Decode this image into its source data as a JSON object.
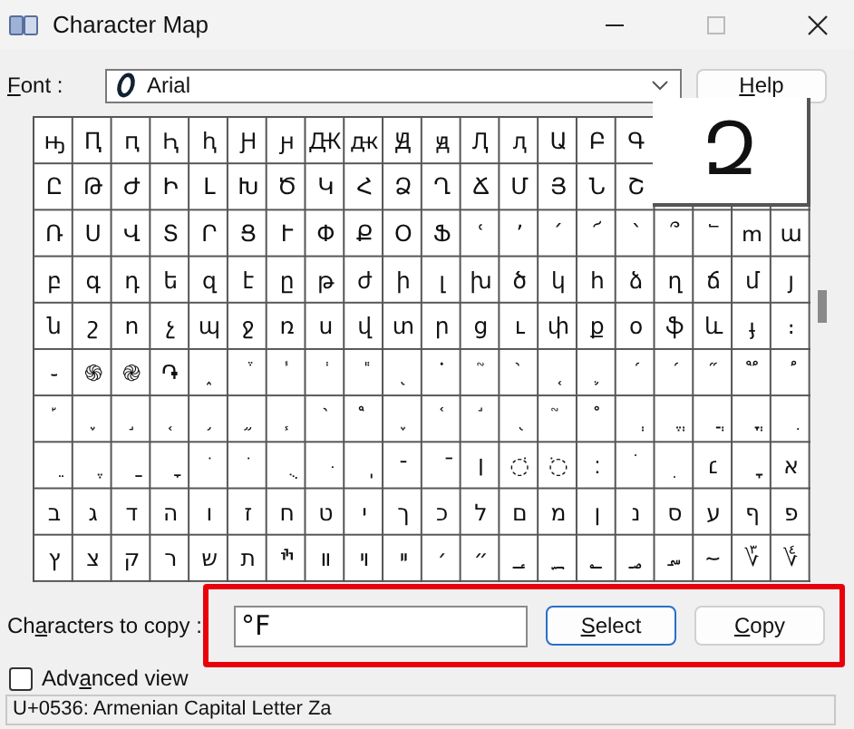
{
  "window": {
    "title": "Character Map"
  },
  "font": {
    "label": "Font :",
    "value": "Arial"
  },
  "help_button": {
    "label": "Help"
  },
  "grid": {
    "rows": [
      [
        "ԣ",
        "Ԥ",
        "ԥ",
        "Ԧ",
        "ԧ",
        "Ԩ",
        "ԩ",
        "Ԫ",
        "ԫ",
        "Ԭ",
        "ԭ",
        "Ԯ",
        "ԯ",
        "Ա",
        "Բ",
        "Գ"
      ],
      [
        "Ը",
        "Թ",
        "Ժ",
        "Ի",
        "Լ",
        "Խ",
        "Ծ",
        "Կ",
        "Հ",
        "Ձ",
        "Ղ",
        "Ճ",
        "Մ",
        "Յ",
        "Ն",
        "Շ"
      ],
      [
        "Ռ",
        "Ս",
        "Վ",
        "Տ",
        "Ր",
        "Ց",
        "Ւ",
        "Փ",
        "Ք",
        "Օ",
        "Ֆ",
        "ՙ",
        "՚",
        "՛",
        "՜",
        "՝",
        "՞",
        "՟",
        "ՠ",
        "ա"
      ],
      [
        "բ",
        "գ",
        "դ",
        "ե",
        "զ",
        "է",
        "ը",
        "թ",
        "ժ",
        "ի",
        "լ",
        "խ",
        "ծ",
        "կ",
        "հ",
        "ձ",
        "ղ",
        "ճ",
        "մ",
        "յ"
      ],
      [
        "ն",
        "շ",
        "ո",
        "չ",
        "պ",
        "ջ",
        "ռ",
        "ս",
        "վ",
        "տ",
        "ր",
        "ց",
        "ւ",
        "փ",
        "ք",
        "օ",
        "ֆ",
        "և",
        "ֈ",
        "։"
      ],
      [
        "֊",
        "֍",
        "֎",
        "֏",
        "֑",
        "֒",
        "֓",
        "֔",
        "֕",
        "֖",
        "֗",
        "֘",
        "֙",
        "֚",
        "֛",
        "֜",
        "֝",
        "֞",
        "֟",
        "֠"
      ],
      [
        "֡",
        "֢",
        "֣",
        "֤",
        "֥",
        "֦",
        "֧",
        "֨",
        "֩",
        "֪",
        "֫",
        "֬",
        "֭",
        "֮",
        "֯",
        "ְ",
        "ֱ",
        "ֲ",
        "ֳ",
        "ִ"
      ],
      [
        "ֵ",
        "ֶ",
        "ַ",
        "ָ",
        "ֹ",
        "ֺ",
        "ֻ",
        "ּ",
        "ֽ",
        "־",
        "ֿ",
        "׀",
        "◌ׁ",
        "◌ׂ",
        "׃",
        "ׄ",
        "ׅ",
        "׆",
        "ׇ",
        "א"
      ],
      [
        "ב",
        "ג",
        "ד",
        "ה",
        "ו",
        "ז",
        "ח",
        "ט",
        "י",
        "ך",
        "כ",
        "ל",
        "ם",
        "מ",
        "ן",
        "נ",
        "ס",
        "ע",
        "ף",
        "פ"
      ],
      [
        "ץ",
        "צ",
        "ק",
        "ר",
        "ש",
        "ת",
        "ׯ",
        "װ",
        "ױ",
        "ײ",
        "׳",
        "״",
        "؀",
        "؁",
        "؂",
        "؃",
        "؄",
        "؅",
        "؆",
        "؇"
      ]
    ],
    "magnified": "Զ"
  },
  "copy": {
    "label": "Characters to copy :",
    "value": "°F"
  },
  "select_button": {
    "label": "Select"
  },
  "copy_button": {
    "label": "Copy"
  },
  "advanced_view": {
    "label": "Advanced view",
    "checked": false
  },
  "status_bar": "U+0536: Armenian Capital Letter Za"
}
